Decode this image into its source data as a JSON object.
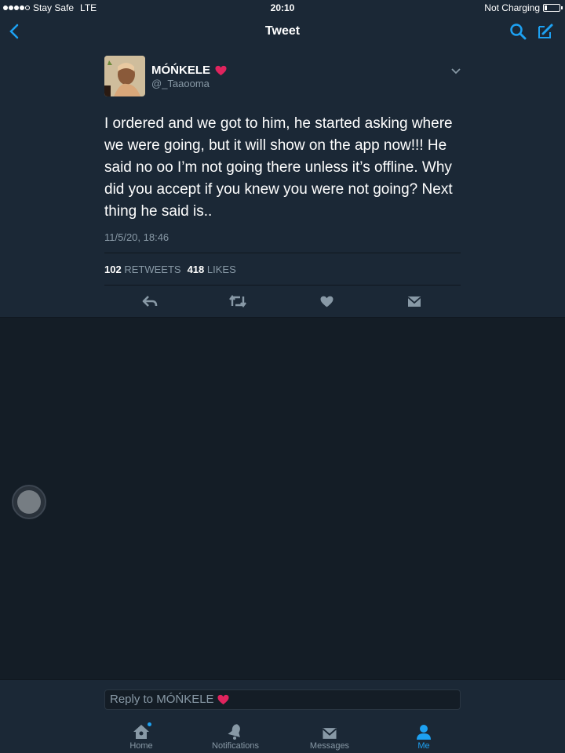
{
  "status_bar": {
    "carrier": "Stay Safe",
    "network": "LTE",
    "time": "20:10",
    "charging": "Not Charging"
  },
  "nav": {
    "title": "Tweet",
    "back_icon": "chevron-left-icon",
    "search_icon": "search-icon",
    "compose_icon": "compose-icon"
  },
  "tweet": {
    "author_name": "MÓŃKELE",
    "author_emoji": "heart-emoji",
    "handle": "@_Taaooma",
    "text": "I ordered and we got to him, he started asking where we were going, but it will show on the app now!!! He said no oo I’m not going there unless it’s offline. Why did you accept if you knew you were not going? Next thing he said is..",
    "timestamp": "11/5/20, 18:46",
    "retweets_count": "102",
    "retweets_label": "RETWEETS",
    "likes_count": "418",
    "likes_label": "LIKES"
  },
  "reply": {
    "placeholder": "Reply to MÓŃKELE"
  },
  "tabs": [
    {
      "label": "Home",
      "icon": "home-icon"
    },
    {
      "label": "Notifications",
      "icon": "bell-icon"
    },
    {
      "label": "Messages",
      "icon": "envelope-icon"
    },
    {
      "label": "Me",
      "icon": "person-icon"
    }
  ],
  "colors": {
    "accent": "#1da1f2",
    "panel": "#1b2836",
    "background": "#141d26",
    "muted": "#8899a6",
    "heart": "#e0245e"
  }
}
